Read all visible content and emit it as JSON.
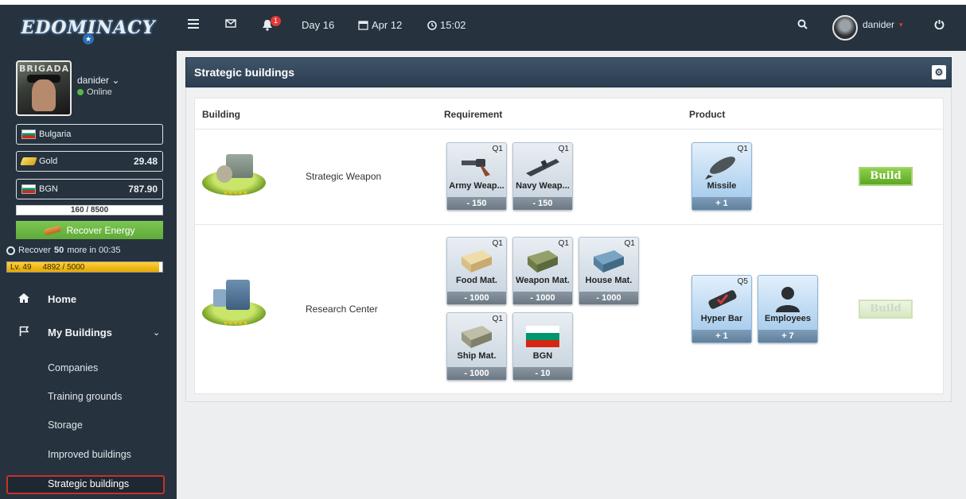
{
  "topbar": {
    "logo": "EDOMINACY",
    "day": "Day 16",
    "date": "Apr 12",
    "time": "15:02",
    "notifications": "1",
    "username": "danider",
    "icons": [
      "menu-icon",
      "mail-icon",
      "bell-icon",
      "calendar-icon",
      "clock-icon",
      "search-icon",
      "power-icon"
    ]
  },
  "sidebar": {
    "avatar_text": "BRIGADA",
    "username": "danider",
    "status": "Online",
    "country": "Bulgaria",
    "gold_label": "Gold",
    "gold_value": "29.48",
    "currency_label": "BGN",
    "currency_value": "787.90",
    "energy": "160 / 8500",
    "energy_fraction": 0.019,
    "recover_button": "Recover Energy",
    "recover_prefix": "Recover",
    "recover_amount": "50",
    "recover_suffix": "more in 00:35",
    "level": "Lv. 49",
    "xp": "4892 / 5000",
    "xp_fraction": 0.978,
    "nav": {
      "home": "Home",
      "my_buildings": "My Buildings",
      "sub": [
        "Companies",
        "Training grounds",
        "Storage",
        "Improved buildings",
        "Strategic buildings"
      ]
    }
  },
  "panel": {
    "title": "Strategic buildings",
    "columns": [
      "Building",
      "Requirement",
      "Product"
    ],
    "rows": [
      {
        "name": "Strategic Weapon",
        "requirements": [
          {
            "name": "Army Weap...",
            "quality": "Q1",
            "qty": "- 150"
          },
          {
            "name": "Navy Weap...",
            "quality": "Q1",
            "qty": "- 150"
          }
        ],
        "products": [
          {
            "name": "Missile",
            "quality": "Q1",
            "qty": "+ 1"
          }
        ],
        "button": "Build",
        "enabled": true
      },
      {
        "name": "Research Center",
        "requirements": [
          {
            "name": "Food Mat.",
            "quality": "Q1",
            "qty": "- 1000"
          },
          {
            "name": "Weapon Mat.",
            "quality": "Q1",
            "qty": "- 1000"
          },
          {
            "name": "House Mat.",
            "quality": "Q1",
            "qty": "- 1000"
          },
          {
            "name": "Ship Mat.",
            "quality": "Q1",
            "qty": "- 1000"
          },
          {
            "name": "BGN",
            "quality": "",
            "qty": "- 10"
          }
        ],
        "products": [
          {
            "name": "Hyper Bar",
            "quality": "Q5",
            "qty": "+ 1"
          },
          {
            "name": "Employees",
            "quality": "",
            "qty": "+ 7"
          }
        ],
        "button": "Build",
        "enabled": false
      }
    ]
  }
}
